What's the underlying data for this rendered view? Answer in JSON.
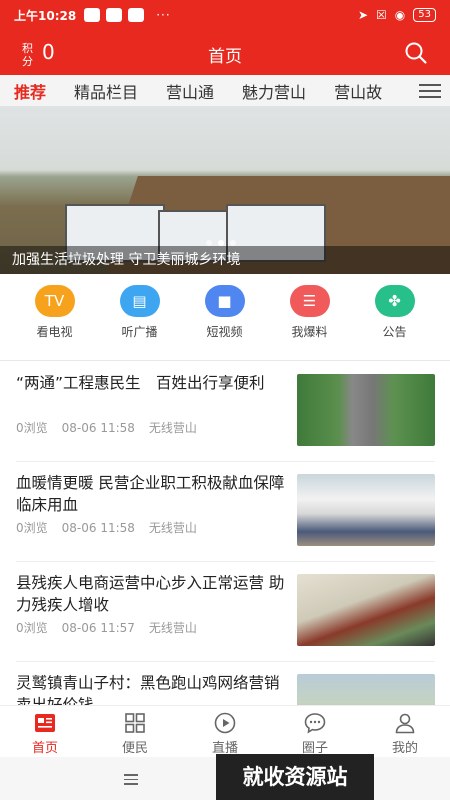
{
  "status": {
    "time": "上午10:28",
    "dots": "···",
    "battery": "53"
  },
  "header": {
    "score_label": "积分",
    "score_value": "0",
    "title": "首页"
  },
  "tabs": [
    "推荐",
    "精品栏目",
    "营山通",
    "魅力营山",
    "营山故"
  ],
  "banner": {
    "caption": "加强生活垃圾处理 守卫美丽城乡环境"
  },
  "quick": [
    {
      "label": "看电视",
      "icon": "tv-icon",
      "color": "#f6a21d",
      "glyph": "TV"
    },
    {
      "label": "听广播",
      "icon": "radio-icon",
      "color": "#3ea6f0",
      "glyph": "▤"
    },
    {
      "label": "短视频",
      "icon": "video-camera-icon",
      "color": "#4f86f0",
      "glyph": "■"
    },
    {
      "label": "我爆料",
      "icon": "report-icon",
      "color": "#f05a5a",
      "glyph": "☰"
    },
    {
      "label": "公告",
      "icon": "announcement-icon",
      "color": "#27c08a",
      "glyph": "✤"
    }
  ],
  "news": [
    {
      "title": "“两通”工程惠民生　百姓出行享便利",
      "views": "0浏览",
      "date": "08-06 11:58",
      "source": "无线营山"
    },
    {
      "title": "血暖情更暖 民营企业职工积极献血保障临床用血",
      "views": "0浏览",
      "date": "08-06 11:58",
      "source": "无线营山"
    },
    {
      "title": "县残疾人电商运营中心步入正常运营 助力残疾人增收",
      "views": "0浏览",
      "date": "08-06 11:57",
      "source": "无线营山"
    },
    {
      "title": "灵鹫镇青山子村：黑色跑山鸡网络营销卖出好价钱",
      "views": "",
      "date": "",
      "source": ""
    }
  ],
  "nav": [
    {
      "label": "首页",
      "icon": "news-icon"
    },
    {
      "label": "便民",
      "icon": "grid-icon"
    },
    {
      "label": "直播",
      "icon": "play-icon"
    },
    {
      "label": "圈子",
      "icon": "chat-icon"
    },
    {
      "label": "我的",
      "icon": "user-icon"
    }
  ],
  "watermark": "就收资源站",
  "colors": {
    "brand": "#e8291f"
  }
}
